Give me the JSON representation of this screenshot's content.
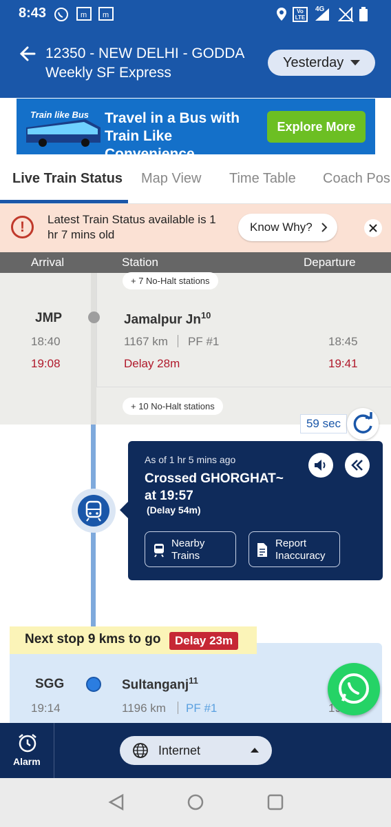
{
  "status_bar": {
    "time": "8:43",
    "network_4g": "4G",
    "network_lte": "LTE"
  },
  "header": {
    "title_line1": "12350 - NEW DELHI - GODDA",
    "title_line2": "Weekly SF Express",
    "day_select": "Yesterday"
  },
  "banner": {
    "tag": "Train like Bus",
    "text_line1": "Travel in a Bus with",
    "text_line2": "Train Like Convenience",
    "cta": "Explore More"
  },
  "tabs": [
    "Live Train Status",
    "Map View",
    "Time Table",
    "Coach Posi"
  ],
  "notice": {
    "line1": "Latest Train Status available is 1",
    "line2": "hr 7 mins old",
    "button": "Know Why?"
  },
  "columns": {
    "arrival": "Arrival",
    "station": "Station",
    "departure": "Departure"
  },
  "no_halt_top": "+ 7 No-Halt stations",
  "no_halt_bottom": "+ 10 No-Halt stations",
  "passed_station": {
    "code": "JMP",
    "name": "Jamalpur Jn",
    "seq": "10",
    "sched_arr": "18:40",
    "act_arr": "19:08",
    "distance": "1167 km",
    "platform": "PF #1",
    "delay": "Delay 28m",
    "sched_dep": "18:45",
    "act_dep": "19:41"
  },
  "refresh_timer": "59 sec",
  "live_card": {
    "as_of": "As of 1 hr 5 mins ago",
    "crossed_line1": "Crossed GHORGHAT~",
    "crossed_line2": "at 19:57",
    "delay": "(Delay 54m)",
    "nearby_line1": "Nearby",
    "nearby_line2": "Trains",
    "report_line1": "Report",
    "report_line2": "Inaccuracy"
  },
  "next_stop": {
    "text": "Next stop 9 kms to go",
    "delay": "Delay 23m"
  },
  "next_station": {
    "code": "SGG",
    "name": "Sultanganj",
    "seq": "11",
    "sched_arr": "19:14",
    "distance": "1196 km",
    "platform": "PF #1",
    "dep_partial": "19"
  },
  "bottom": {
    "alarm": "Alarm",
    "internet": "Internet"
  },
  "colors": {
    "primary": "#1a57a9",
    "dark_navy": "#0f2b5b",
    "delay_red": "#b0192b",
    "notice_bg": "#fbe1d4",
    "passed_bg": "#ededea",
    "next_bg": "#d9e8f8",
    "whatsapp": "#25d366"
  }
}
